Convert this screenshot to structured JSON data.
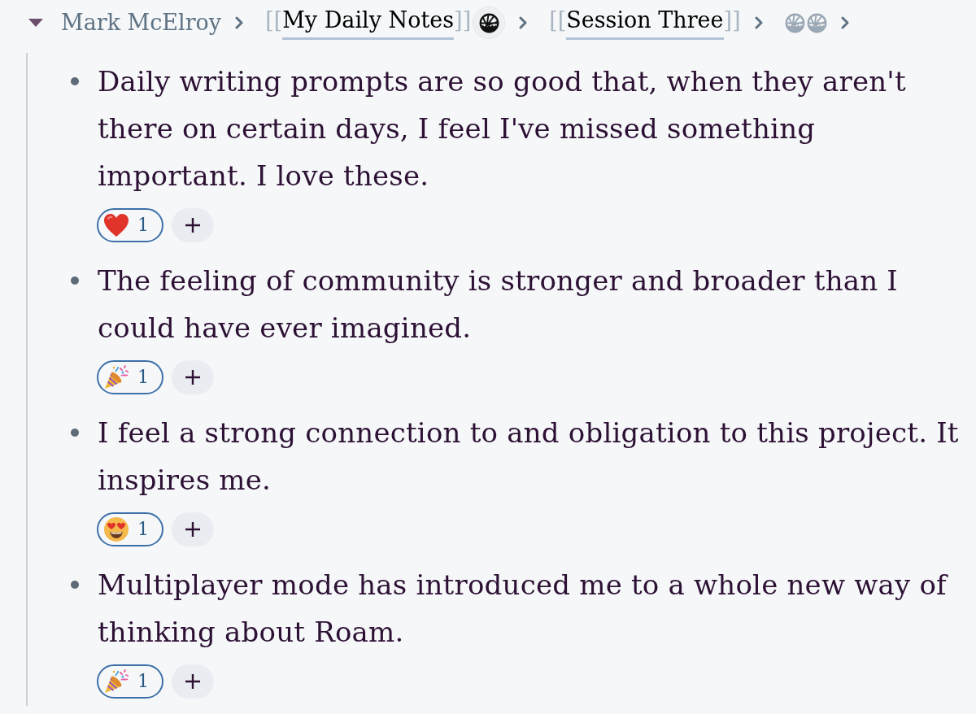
{
  "breadcrumb": {
    "expanded": true,
    "crumbs": [
      {
        "parts": [
          {
            "kind": "text",
            "label": "Mark McElroy"
          }
        ]
      },
      {
        "parts": [
          {
            "kind": "page_link",
            "open": "[[",
            "label": "My Daily Notes",
            "close": "]]"
          },
          {
            "kind": "emblem",
            "highlighted": true
          }
        ]
      },
      {
        "parts": [
          {
            "kind": "page_link",
            "open": "[[",
            "label": "Session Three",
            "close": "]]"
          }
        ]
      },
      {
        "parts": [
          {
            "kind": "emblem",
            "highlighted": false
          },
          {
            "kind": "emblem",
            "highlighted": false
          }
        ]
      }
    ]
  },
  "blocks": [
    {
      "text": "Daily writing prompts are so good that, when they aren't there on certain days, I feel I've missed something important. I love these.",
      "reactions": [
        {
          "kind": "heart",
          "count": "1",
          "selected": true
        }
      ]
    },
    {
      "text": "The feeling of community is stronger and broader than I could have ever imagined.",
      "reactions": [
        {
          "kind": "party_popper",
          "count": "1",
          "selected": true
        }
      ]
    },
    {
      "text": "I feel a strong connection to and obligation to this project. It inspires me.",
      "reactions": [
        {
          "kind": "heart_eyes",
          "count": "1",
          "selected": true
        }
      ]
    },
    {
      "text": "Multiplayer mode has introduced me to a whole new way of thinking about Roam.",
      "reactions": [
        {
          "kind": "party_popper",
          "count": "1",
          "selected": true
        }
      ]
    }
  ]
}
